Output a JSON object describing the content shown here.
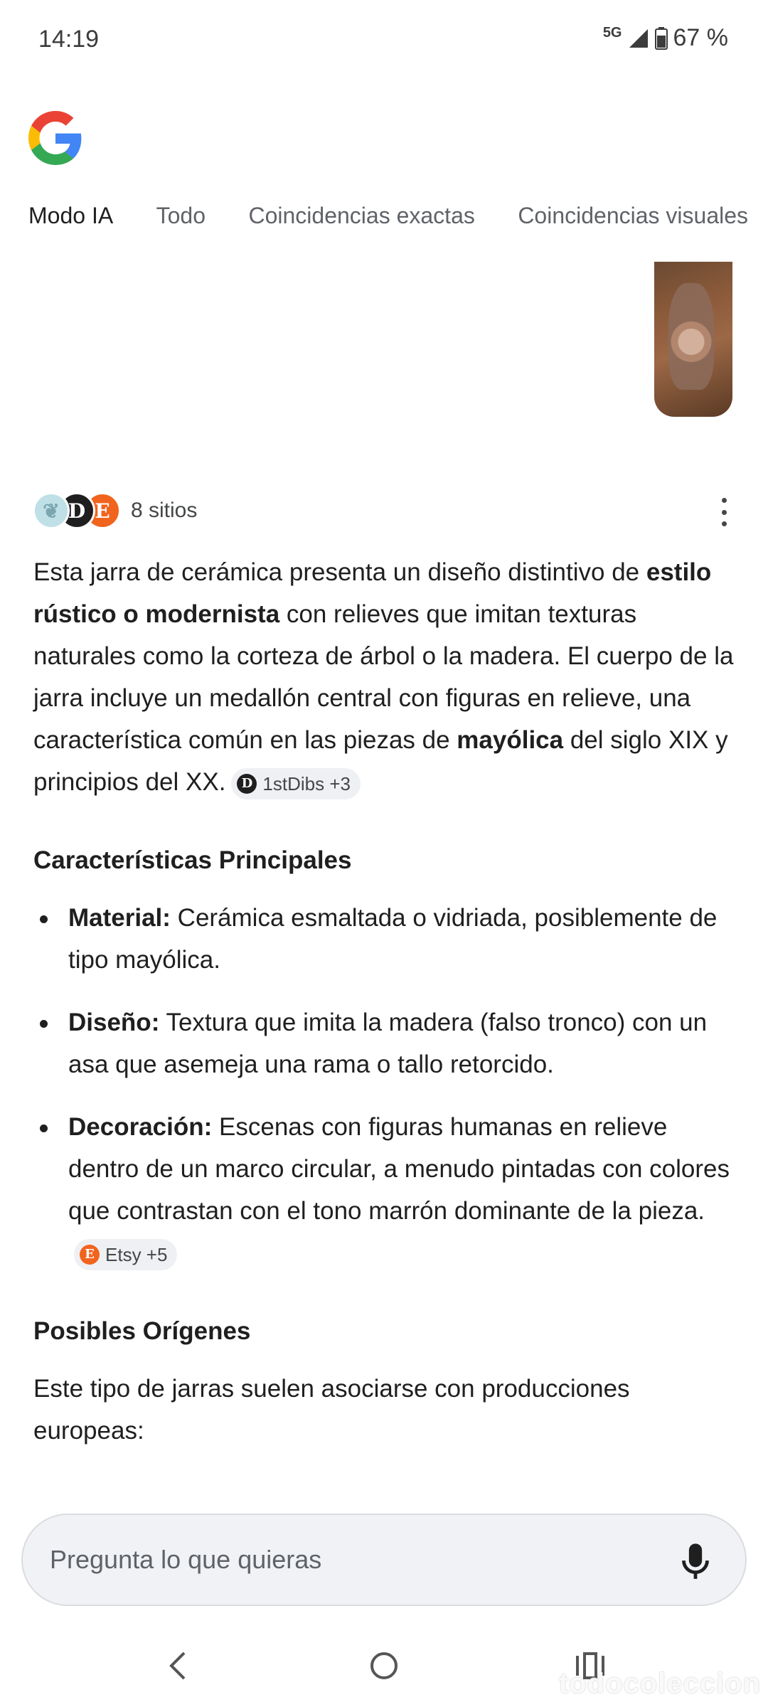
{
  "status": {
    "time": "14:19",
    "network": "5G",
    "battery": "67 %"
  },
  "tabs": [
    {
      "label": "Modo IA",
      "active": true
    },
    {
      "label": "Todo"
    },
    {
      "label": "Coincidencias exactas"
    },
    {
      "label": "Coincidencias visuales"
    }
  ],
  "sources": {
    "count_label": "8 sitios",
    "icons": [
      "leaf-site-icon",
      "1stdibs-icon",
      "etsy-icon"
    ]
  },
  "answer": {
    "p1_a": "Esta jarra de cerámica presenta un diseño distintivo de ",
    "p1_b": "estilo rústico o modernista",
    "p1_c": " con relieves que imitan texturas naturales como la corteza de árbol o la madera. El cuerpo de la jarra incluye un medallón central con figuras en relieve, una característica común en las piezas de ",
    "p1_d": "mayólica",
    "p1_e": " del siglo XIX y principios del XX.",
    "chip1": "1stDibs +3"
  },
  "features": {
    "heading": "Características Principales",
    "items": [
      {
        "label": "Material:",
        "text": " Cerámica esmaltada o vidriada, posiblemente de tipo mayólica."
      },
      {
        "label": "Diseño:",
        "text": " Textura que imita la madera (falso tronco) con un asa que asemeja una rama o tallo retorcido."
      },
      {
        "label": "Decoración:",
        "text": " Escenas con figuras humanas en relieve dentro de un marco circular, a menudo pintadas con colores que contrastan con el tono marrón dominante de la pieza.",
        "chip": "Etsy +5"
      }
    ]
  },
  "origins": {
    "heading": "Posibles Orígenes",
    "text": "Este tipo de jarras suelen asociarse con producciones europeas:"
  },
  "search": {
    "placeholder": "Pregunta lo que quieras"
  },
  "watermark": "todocoleccion"
}
